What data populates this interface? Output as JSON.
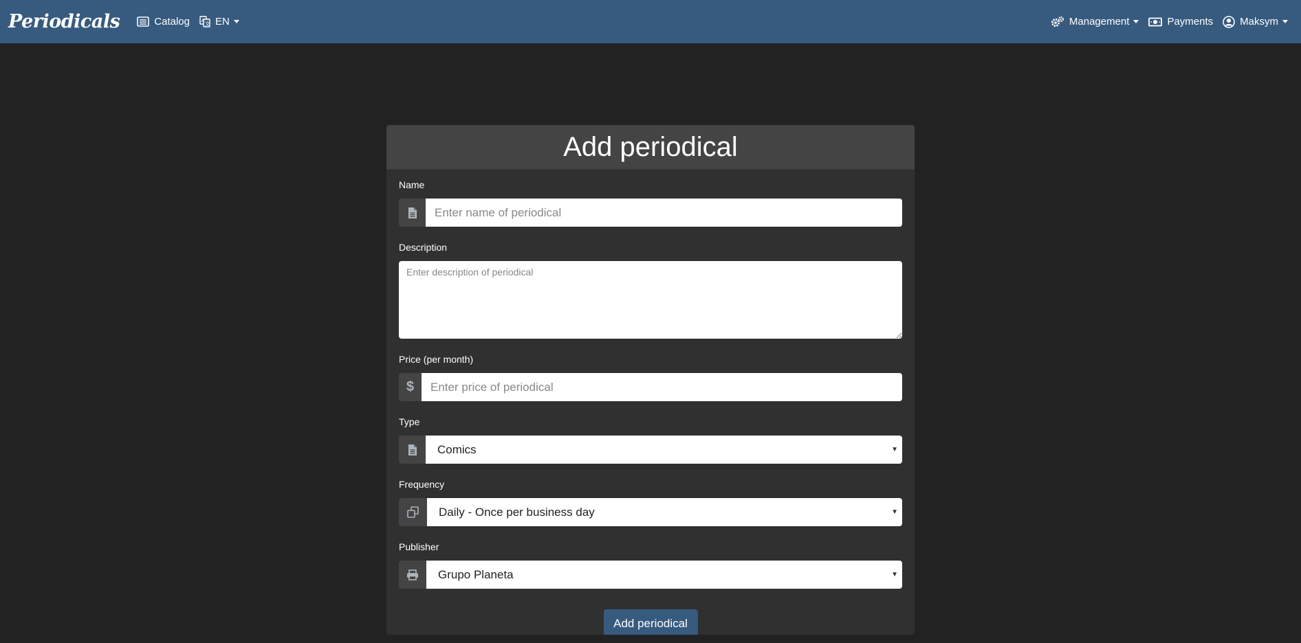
{
  "navbar": {
    "brand": "Periodicals",
    "catalog_label": "Catalog",
    "language_label": "EN",
    "management_label": "Management",
    "payments_label": "Payments",
    "user_label": "Maksym"
  },
  "form": {
    "title": "Add periodical",
    "name": {
      "label": "Name",
      "placeholder": "Enter name of periodical",
      "value": ""
    },
    "description": {
      "label": "Description",
      "placeholder": "Enter description of periodical",
      "value": ""
    },
    "price": {
      "label": "Price (per month)",
      "placeholder": "Enter price of periodical",
      "value": ""
    },
    "type": {
      "label": "Type",
      "selected": "Comics"
    },
    "frequency": {
      "label": "Frequency",
      "selected": "Daily - Once per business day"
    },
    "publisher": {
      "label": "Publisher",
      "selected": "Grupo Planeta"
    },
    "submit_label": "Add periodical"
  },
  "icons": {
    "name": "document-icon",
    "price": "dollar-icon",
    "type": "document-icon",
    "frequency": "copy-icon",
    "publisher": "printer-icon"
  },
  "colors": {
    "navbar": "#375a7f",
    "background": "#222222",
    "card": "#303030",
    "card_header": "#444444",
    "button": "#375a7f"
  }
}
